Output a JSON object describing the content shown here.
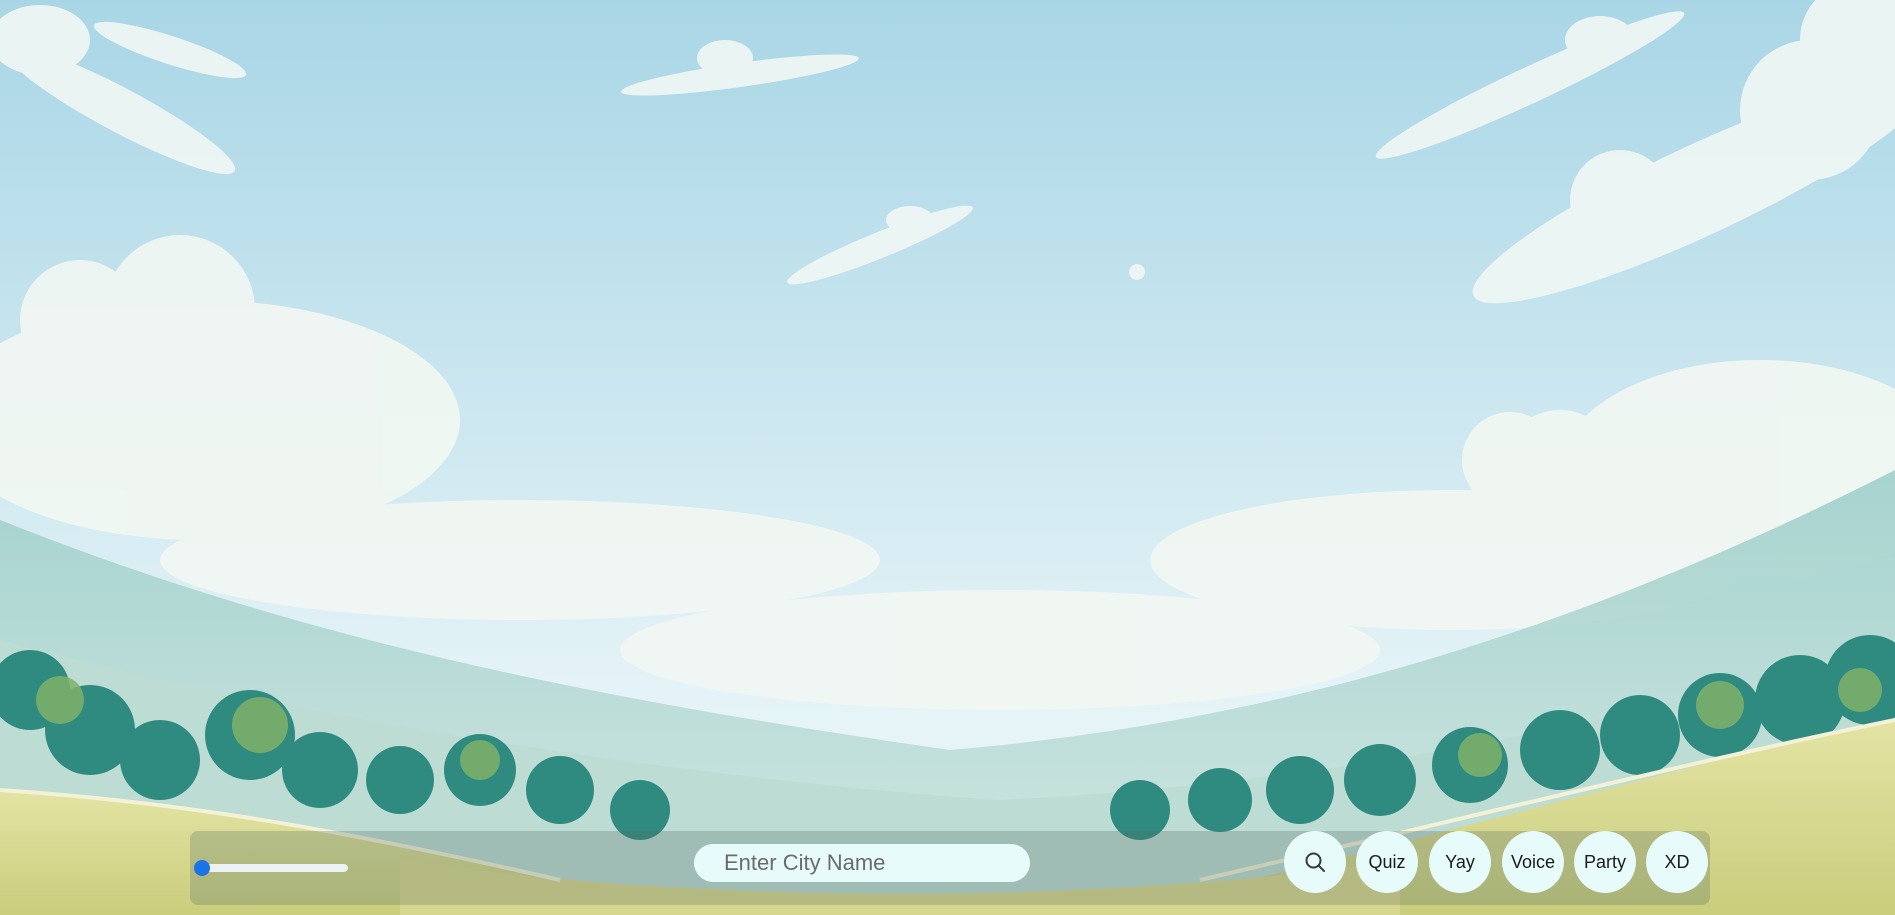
{
  "background": {
    "description_icon": "landscape-illustration",
    "colors": {
      "sky_top": "#a9d6e6",
      "sky_bottom": "#e4f3f7",
      "cloud": "#eef6f4",
      "hill_far": "#8fc6c2",
      "hill_mid": "#b8d9d2",
      "bush_dark": "#2f8a80",
      "bush_light": "#7fb06a",
      "meadow": "#d8d78f"
    }
  },
  "toolbar": {
    "volume": {
      "value": 0,
      "accent": "#1a73e8"
    },
    "search": {
      "placeholder": "Enter City Name",
      "value": "",
      "icon": "search-icon"
    },
    "buttons": {
      "quiz": "Quiz",
      "yay": "Yay",
      "voice": "Voice",
      "party": "Party",
      "xd": "XD"
    }
  }
}
